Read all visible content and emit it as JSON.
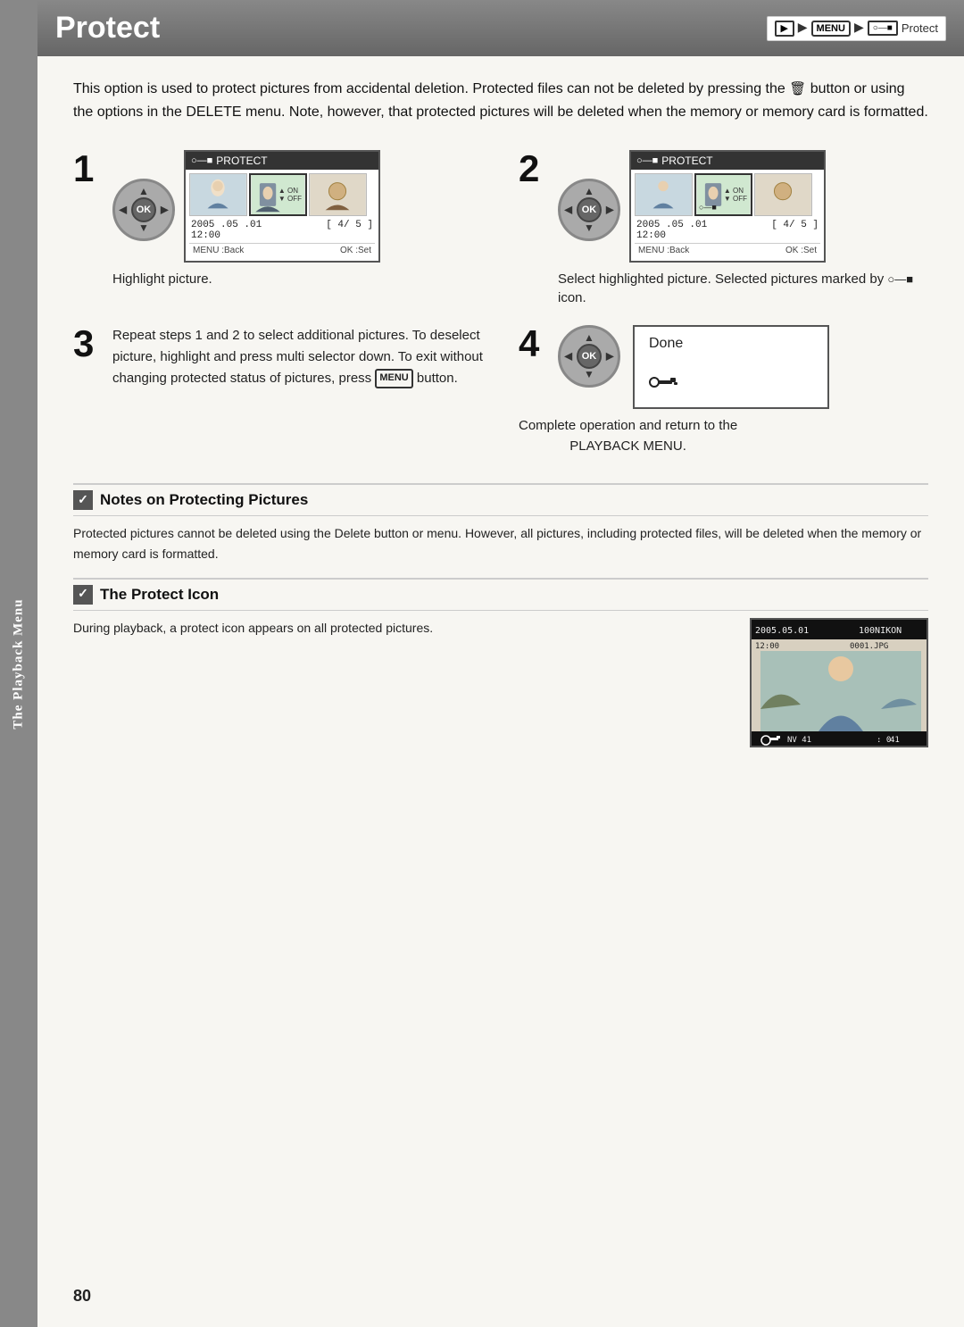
{
  "sidebar": {
    "label": "The Playback Menu"
  },
  "header": {
    "title": "Protect",
    "nav": {
      "play_icon": "▶",
      "menu_label": "MENU",
      "protect_nav_text": "Protect"
    }
  },
  "intro": {
    "text": "This option is used to protect pictures from accidental deletion. Protected files can not be deleted by pressing the  button or using the options in the DELETE menu. Note, however, that protected pictures will be deleted when the memory or memory card is formatted."
  },
  "steps": {
    "step1": {
      "number": "1",
      "screen_title": "PROTECT",
      "date": "2005 .05 .01",
      "time": "12:00",
      "frame": "4/ 5",
      "back_label": "MENU :Back",
      "set_label": "OK :Set",
      "on_label": "ON",
      "off_label": "OFF",
      "caption": "Highlight picture."
    },
    "step2": {
      "number": "2",
      "screen_title": "PROTECT",
      "date": "2005 .05 .01",
      "time": "12:00",
      "frame": "4/ 5",
      "back_label": "MENU :Back",
      "set_label": "OK :Set",
      "on_label": "ON",
      "off_label": "OFF",
      "caption": "Select highlighted picture. Selected pictures marked by  icon."
    },
    "step3": {
      "number": "3",
      "text": "Repeat steps 1 and 2 to select additional pictures. To deselect picture, highlight and press multi selector down. To exit without changing protected status of pictures, press  button."
    },
    "step4": {
      "number": "4",
      "done_label": "Done",
      "protect_icon": "○—■",
      "caption_line1": "Complete operation and return to the",
      "caption_line2": "PLAYBACK MENU."
    }
  },
  "notes": {
    "section1": {
      "title": "Notes on Protecting Pictures",
      "body": "Protected pictures cannot be deleted using the Delete button or menu. However, all pictures, including protected files, will be deleted when the memory or memory card is formatted."
    },
    "section2": {
      "title": "The Protect Icon",
      "body": "During playback, a protect icon appears on all protected pictures."
    }
  },
  "footer": {
    "page_number": "80"
  }
}
